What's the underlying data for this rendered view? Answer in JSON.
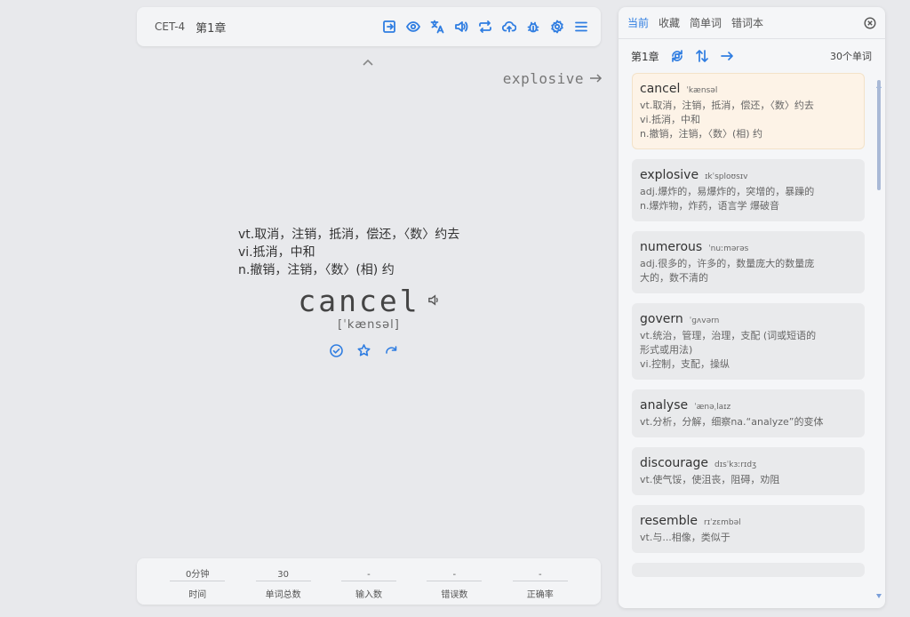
{
  "topbar": {
    "dict_name": "CET-4",
    "chapter": "第1章",
    "icons": [
      "export-icon",
      "eye-icon",
      "translate-icon",
      "speaker-icon",
      "loop-icon",
      "cloud-upload-icon",
      "bug-icon",
      "gear-icon",
      "menu-icon"
    ]
  },
  "next_word": {
    "label": "explosive"
  },
  "current": {
    "translations": [
      "vt.取消，注销，抵消，偿还，〈数〉约去",
      "vi.抵消，中和",
      "n.撤销，注销，〈数〉(相) 约"
    ],
    "word": "cancel",
    "phonetic": "[ˈkænsəl]"
  },
  "stats": [
    {
      "value": "0分钟",
      "label": "时间"
    },
    {
      "value": "30",
      "label": "单词总数"
    },
    {
      "value": "-",
      "label": "输入数"
    },
    {
      "value": "-",
      "label": "错误数"
    },
    {
      "value": "-",
      "label": "正确率"
    }
  ],
  "panel": {
    "tabs": [
      "当前",
      "收藏",
      "简单词",
      "错词本"
    ],
    "active_tab": 0,
    "chapter": "第1章",
    "count": "30个单词",
    "words": [
      {
        "word": "cancel",
        "phonetic": "ˈkænsəl",
        "trans": "vt.取消，注销，抵消，偿还，〈数〉约去\nvi.抵消，中和\nn.撤销，注销，〈数〉(相) 约",
        "active": true
      },
      {
        "word": "explosive",
        "phonetic": "ɪkˈsploʊsɪv",
        "trans": "adj.爆炸的，易爆炸的，突增的，暴躁的\nn.爆炸物，炸药，语言学 爆破音"
      },
      {
        "word": "numerous",
        "phonetic": "ˈnuːmərəs",
        "trans": "adj.很多的，许多的，数量庞大的数量庞\n大的，数不清的"
      },
      {
        "word": "govern",
        "phonetic": "ˈɡʌvərn",
        "trans": "vt.统治，管理，治理，支配 (词或短语的\n形式或用法)\nvi.控制，支配，操纵"
      },
      {
        "word": "analyse",
        "phonetic": "ˈænəˌlaɪz",
        "trans": "vt.分析，分解，细察na.“analyze”的变体"
      },
      {
        "word": "discourage",
        "phonetic": "dɪsˈkɜːrɪdʒ",
        "trans": "vt.使气馁，使沮丧，阻碍，劝阻"
      },
      {
        "word": "resemble",
        "phonetic": "rɪˈzɛmbəl",
        "trans": "vt.与...相像，类似于"
      }
    ]
  },
  "colors": {
    "accent": "#2f7de1",
    "active_card": "#fdf3e7"
  }
}
